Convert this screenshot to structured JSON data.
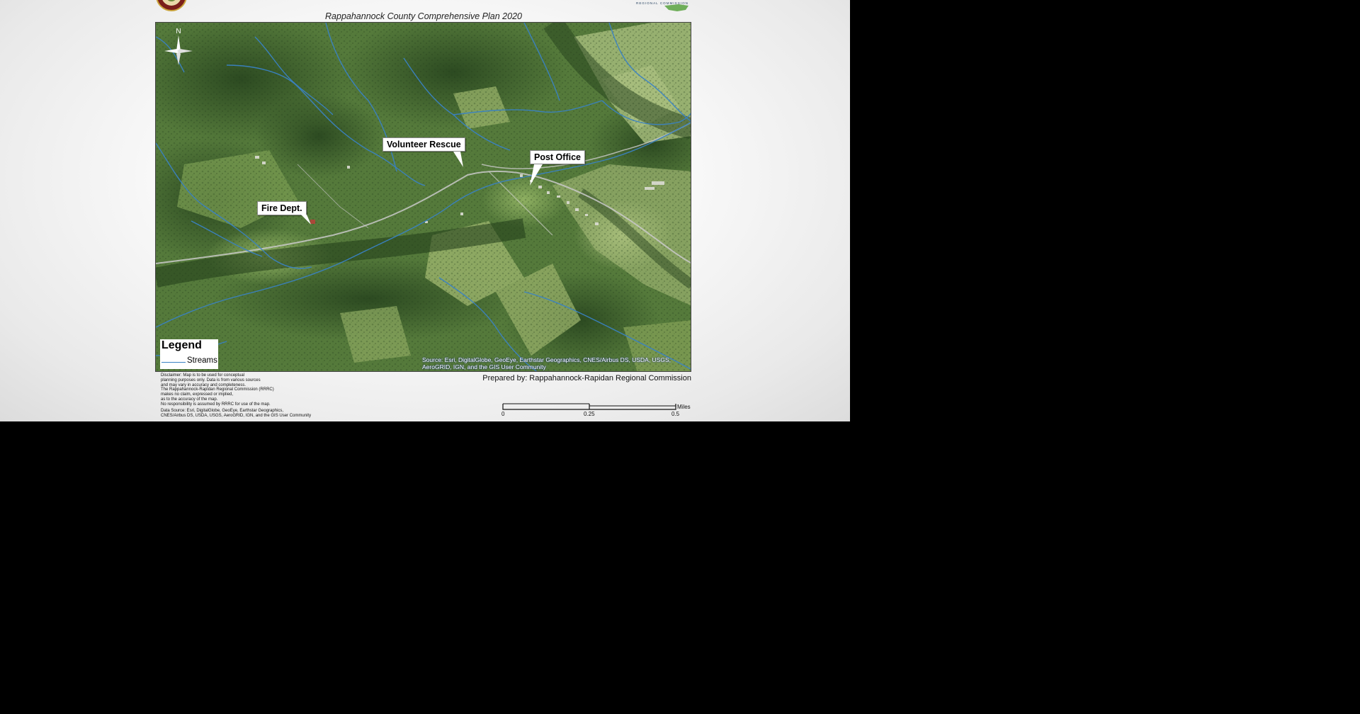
{
  "map": {
    "title": "Rappahannock County Comprehensive Plan 2020",
    "north_label": "N",
    "callouts": {
      "volunteer_rescue": "Volunteer Rescue",
      "post_office": "Post Office",
      "fire_dept": "Fire Dept."
    },
    "legend": {
      "title": "Legend",
      "items": [
        {
          "label": "Streams",
          "color": "#3a82c4"
        }
      ]
    },
    "attribution": "Source: Esri, DigitalGlobe, GeoEye, Earthstar Geographics, CNES/Airbus DS, USDA, USGS, AeroGRID, IGN, and the GIS User Community",
    "basemap": "satellite imagery",
    "stream_color": "#3a82c4",
    "road_color": "#c9c9c9"
  },
  "footer": {
    "prepared_by": "Prepared by: Rappahannock-Rapidan Regional Commission",
    "disclaimer": [
      "Disclaimer: Map is to be used for conceptual",
      "planning purposes only. Data is from various sources",
      "and may vary in accuracy and completeness.",
      "The Rappahannock-Rapidan Regional Commission (RRRC)",
      "makes no claim, expressed or implied,",
      " as to the accuracy of the map.",
      "No responsibility is assumed by RRRC for use of the map."
    ],
    "data_source": [
      "Data Source: Esri, DigitalGlobe, GeoEye, Earthstar Geographics,",
      "CNES/Airbus DS, USDA, USGS, AeroGRID, IGN, and the GIS User Community"
    ],
    "scale": {
      "unit": "Miles",
      "labels": [
        "0",
        "0.25",
        "0.5"
      ]
    }
  },
  "logos": {
    "right_logo_text": "REGIONAL COMMISSION"
  }
}
